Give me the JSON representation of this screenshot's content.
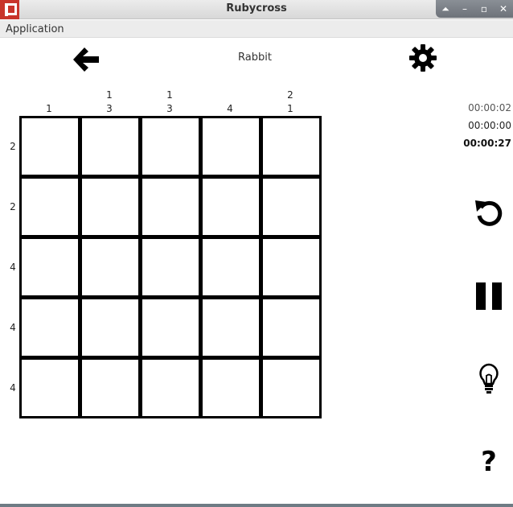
{
  "window": {
    "title": "Rubycross",
    "controls": [
      "⏶",
      "–",
      "▫",
      "✕"
    ]
  },
  "menu": {
    "items": [
      {
        "label": "Application"
      }
    ]
  },
  "header": {
    "puzzle_name": "Rabbit",
    "back_icon": "arrow-left-icon",
    "settings_icon": "gear-icon"
  },
  "puzzle": {
    "col_clues": [
      [
        "1"
      ],
      [
        "1",
        "3"
      ],
      [
        "1",
        "3"
      ],
      [
        "4"
      ],
      [
        "2",
        "1"
      ]
    ],
    "row_clues": [
      "2",
      "2",
      "4",
      "4",
      "4"
    ]
  },
  "timers": {
    "t1": "00:00:02",
    "t2": "00:00:00",
    "t3": "00:00:27"
  },
  "controls": {
    "reset_icon": "undo-icon",
    "pause_icon": "pause-icon",
    "hint_icon": "lightbulb-icon",
    "help": "?"
  }
}
